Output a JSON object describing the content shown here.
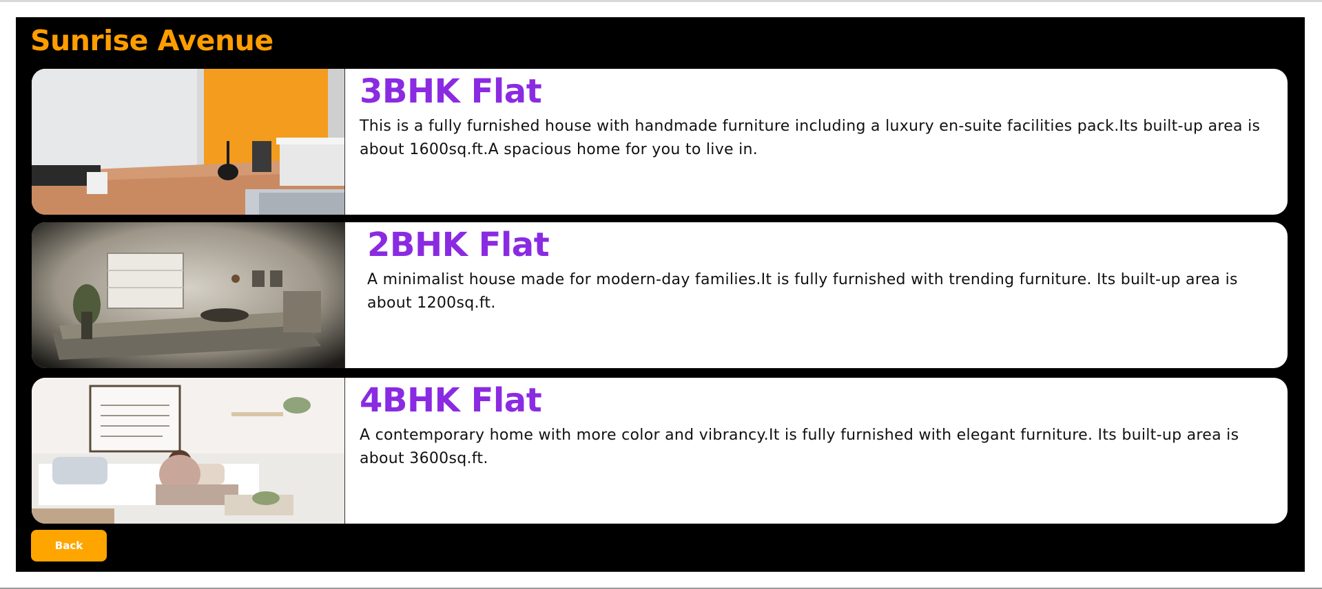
{
  "page": {
    "title": "Sunrise Avenue"
  },
  "listings": [
    {
      "title": "3BHK Flat",
      "description": "This is a fully furnished house with handmade furniture including a luxury en-suite facilities pack.Its built-up area is about 1600sq.ft.A spacious home for you to live in."
    },
    {
      "title": "2BHK Flat",
      "description": "A minimalist house made for modern-day families.It is fully furnished with trending furniture. Its built-up area is about 1200sq.ft."
    },
    {
      "title": "4BHK Flat",
      "description": "A contemporary home with more color and vibrancy.It is fully furnished with elegant furniture. Its built-up area is about 3600sq.ft."
    }
  ],
  "actions": {
    "back_label": "Back"
  },
  "colors": {
    "panel_bg": "#000000",
    "site_title": "#ff9d00",
    "card_title": "#8a2be2",
    "button_bg": "#ffa500"
  }
}
